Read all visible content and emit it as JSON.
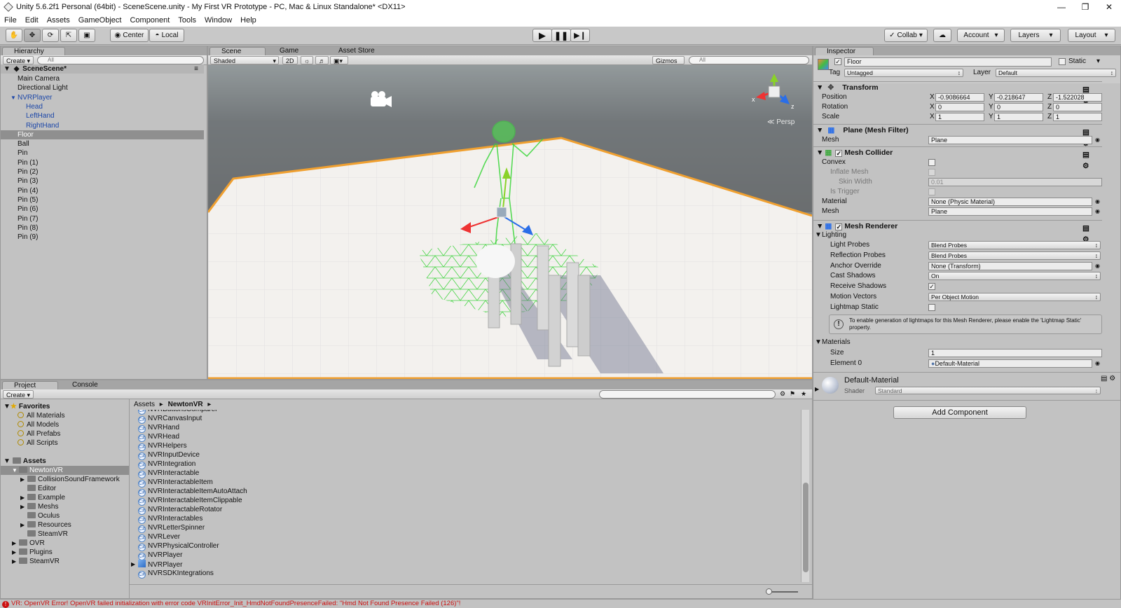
{
  "window": {
    "title": "Unity 5.6.2f1 Personal (64bit) - SceneScene.unity - My First VR Prototype - PC, Mac & Linux Standalone* <DX11>"
  },
  "menu": [
    "File",
    "Edit",
    "Assets",
    "GameObject",
    "Component",
    "Tools",
    "Window",
    "Help"
  ],
  "toolbar": {
    "center": "Center",
    "local": "Local",
    "collab": "Collab",
    "account": "Account",
    "layers": "Layers",
    "layout": "Layout"
  },
  "hierarchy": {
    "tab": "Hierarchy",
    "create": "Create",
    "search_placeholder": "All",
    "scene": "SceneScene*",
    "items": [
      {
        "label": "Main Camera",
        "indent": 1,
        "style": "normal"
      },
      {
        "label": "Directional Light",
        "indent": 1,
        "style": "normal"
      },
      {
        "label": "NVRPlayer",
        "indent": 1,
        "style": "blue"
      },
      {
        "label": "Head",
        "indent": 2,
        "style": "blue"
      },
      {
        "label": "LeftHand",
        "indent": 2,
        "style": "blue"
      },
      {
        "label": "RightHand",
        "indent": 2,
        "style": "blue"
      },
      {
        "label": "Floor",
        "indent": 1,
        "style": "selected"
      },
      {
        "label": "Ball",
        "indent": 1,
        "style": "normal"
      },
      {
        "label": "Pin",
        "indent": 1,
        "style": "normal"
      },
      {
        "label": "Pin (1)",
        "indent": 1,
        "style": "normal"
      },
      {
        "label": "Pin (2)",
        "indent": 1,
        "style": "normal"
      },
      {
        "label": "Pin (3)",
        "indent": 1,
        "style": "normal"
      },
      {
        "label": "Pin (4)",
        "indent": 1,
        "style": "normal"
      },
      {
        "label": "Pin (5)",
        "indent": 1,
        "style": "normal"
      },
      {
        "label": "Pin (6)",
        "indent": 1,
        "style": "normal"
      },
      {
        "label": "Pin (7)",
        "indent": 1,
        "style": "normal"
      },
      {
        "label": "Pin (8)",
        "indent": 1,
        "style": "normal"
      },
      {
        "label": "Pin (9)",
        "indent": 1,
        "style": "normal"
      }
    ]
  },
  "scene": {
    "tabs": [
      "Scene",
      "Game",
      "Asset Store"
    ],
    "shading": "Shaded",
    "mode2d": "2D",
    "gizmos": "Gizmos",
    "search_placeholder": "All",
    "persp": "Persp",
    "axis_x": "x",
    "axis_z": "z"
  },
  "inspector": {
    "tab": "Inspector",
    "object_name": "Floor",
    "static_label": "Static",
    "tag_label": "Tag",
    "tag_value": "Untagged",
    "layer_label": "Layer",
    "layer_value": "Default",
    "transform": {
      "title": "Transform",
      "position": {
        "label": "Position",
        "x": "-0.9086664",
        "y": "-0.218647",
        "z": "-1.522028"
      },
      "rotation": {
        "label": "Rotation",
        "x": "0",
        "y": "0",
        "z": "0"
      },
      "scale": {
        "label": "Scale",
        "x": "1",
        "y": "1",
        "z": "1"
      }
    },
    "mesh_filter": {
      "title": "Plane (Mesh Filter)",
      "mesh_label": "Mesh",
      "mesh_value": "Plane"
    },
    "mesh_collider": {
      "title": "Mesh Collider",
      "convex": "Convex",
      "inflate": "Inflate Mesh",
      "skin_width": "Skin Width",
      "skin_value": "0.01",
      "is_trigger": "Is Trigger",
      "material_label": "Material",
      "material_value": "None (Physic Material)",
      "mesh_label": "Mesh",
      "mesh_value": "Plane"
    },
    "mesh_renderer": {
      "title": "Mesh Renderer",
      "lighting": "Lighting",
      "light_probes": "Light Probes",
      "light_probes_value": "Blend Probes",
      "reflection_probes": "Reflection Probes",
      "reflection_probes_value": "Blend Probes",
      "anchor_override": "Anchor Override",
      "anchor_value": "None (Transform)",
      "cast_shadows": "Cast Shadows",
      "cast_shadows_value": "On",
      "receive_shadows": "Receive Shadows",
      "motion_vectors": "Motion Vectors",
      "motion_vectors_value": "Per Object Motion",
      "lightmap_static": "Lightmap Static",
      "info": "To enable generation of lightmaps for this Mesh Renderer, please enable the 'Lightmap Static' property.",
      "materials": "Materials",
      "size_label": "Size",
      "size_value": "1",
      "element_label": "Element 0",
      "element_value": "Default-Material"
    },
    "material": {
      "name": "Default-Material",
      "shader_label": "Shader",
      "shader_value": "Standard"
    },
    "add_component": "Add Component"
  },
  "project": {
    "tabs": [
      "Project",
      "Console"
    ],
    "create": "Create",
    "favorites_title": "Favorites",
    "favorites": [
      "All Materials",
      "All Models",
      "All Prefabs",
      "All Scripts"
    ],
    "assets_title": "Assets",
    "tree": [
      {
        "label": "NewtonVR",
        "level": 1,
        "selected": true,
        "arrow": "open"
      },
      {
        "label": "CollisionSoundFramework",
        "level": 2,
        "arrow": "closed"
      },
      {
        "label": "Editor",
        "level": 2,
        "arrow": "none"
      },
      {
        "label": "Example",
        "level": 2,
        "arrow": "closed"
      },
      {
        "label": "Meshs",
        "level": 2,
        "arrow": "closed"
      },
      {
        "label": "Oculus",
        "level": 2,
        "arrow": "none"
      },
      {
        "label": "Resources",
        "level": 2,
        "arrow": "closed"
      },
      {
        "label": "SteamVR",
        "level": 2,
        "arrow": "none"
      },
      {
        "label": "OVR",
        "level": 1,
        "arrow": "closed"
      },
      {
        "label": "Plugins",
        "level": 1,
        "arrow": "closed"
      },
      {
        "label": "SteamVR",
        "level": 1,
        "arrow": "closed"
      }
    ],
    "breadcrumb": [
      "Assets",
      "NewtonVR"
    ],
    "files": [
      {
        "label": "NVRButtonsComparer",
        "kind": "script"
      },
      {
        "label": "NVRCanvasInput",
        "kind": "script"
      },
      {
        "label": "NVRHand",
        "kind": "script"
      },
      {
        "label": "NVRHead",
        "kind": "script"
      },
      {
        "label": "NVRHelpers",
        "kind": "script"
      },
      {
        "label": "NVRInputDevice",
        "kind": "script"
      },
      {
        "label": "NVRIntegration",
        "kind": "script"
      },
      {
        "label": "NVRInteractable",
        "kind": "script"
      },
      {
        "label": "NVRInteractableItem",
        "kind": "script"
      },
      {
        "label": "NVRInteractableItemAutoAttach",
        "kind": "script"
      },
      {
        "label": "NVRInteractableItemClippable",
        "kind": "script"
      },
      {
        "label": "NVRInteractableRotator",
        "kind": "script"
      },
      {
        "label": "NVRInteractables",
        "kind": "script"
      },
      {
        "label": "NVRLetterSpinner",
        "kind": "script"
      },
      {
        "label": "NVRLever",
        "kind": "script"
      },
      {
        "label": "NVRPhysicalController",
        "kind": "script"
      },
      {
        "label": "NVRPlayer",
        "kind": "script"
      },
      {
        "label": "NVRPlayer",
        "kind": "prefab"
      },
      {
        "label": "NVRSDKIntegrations",
        "kind": "script"
      }
    ]
  },
  "status": {
    "message": "VR: OpenVR Error! OpenVR failed initialization with error code VRInitError_Init_HmdNotFoundPresenceFailed: \"Hmd Not Found Presence Failed (126)\"!"
  },
  "colors": {
    "accent_orange": "#f0a030",
    "selection": "#8f8f8f",
    "link_blue": "#1b46a8",
    "error_red": "#cc1010"
  }
}
